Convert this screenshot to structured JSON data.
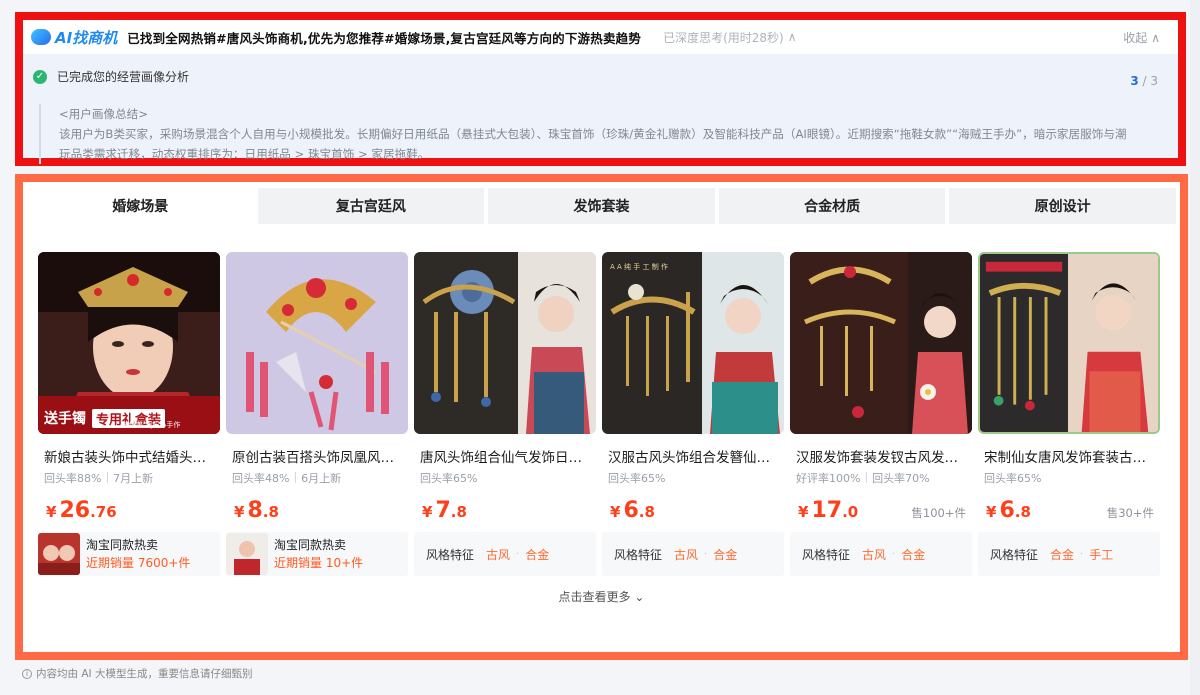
{
  "header": {
    "logo_text": "AI找商机",
    "headline": "已找到全网热销#唐风头饰商机,优先为您推荐#婚嫁场景,复古宫廷风等方向的下游热卖趋势",
    "thinking": "已深度思考(用时28秒)",
    "collapse_label": "收起"
  },
  "analysis": {
    "step_title": "已完成您的经营画像分析",
    "step_current": "3",
    "step_total": "/ 3",
    "summary_heading": "<用户画像总结>",
    "summary_body": "该用户为B类买家，采购场景混含个人自用与小规模批发。长期偏好日用纸品（悬挂式大包装）、珠宝首饰（珍珠/黄金礼赠款）及智能科技产品（AI眼镜）。近期搜索“拖鞋女款”“海贼王手办”，暗示家居服饰与潮玩品类需求迁移，动态权重排序为：日用纸品 > 珠宝首饰 > 家居拖鞋。"
  },
  "tabs": [
    {
      "label": "婚嫁场景"
    },
    {
      "label": "复古宫廷风"
    },
    {
      "label": "发饰套装"
    },
    {
      "label": "合金材质"
    },
    {
      "label": "原创设计"
    }
  ],
  "products": [
    {
      "title": "新娘古装头饰中式结婚头…",
      "meta1": "回头率88%",
      "meta2": "7月上新",
      "price_int": "26",
      "price_dec": ".76",
      "currency": "¥",
      "sold": "",
      "overlay1": "送手镯",
      "overlay2": "专用礼盒装",
      "overlay3": "苏绣美学|匠心手作",
      "foot_label": "淘宝同款热卖",
      "foot_sales": "近期销量 7600+件"
    },
    {
      "title": "原创古装百搭头饰凤凰风…",
      "meta1": "回头率48%",
      "meta2": "6月上新",
      "price_int": "8",
      "price_dec": ".8",
      "currency": "¥",
      "sold": "",
      "foot_label": "淘宝同款热卖",
      "foot_sales": "近期销量 10+件"
    },
    {
      "title": "唐风头饰组合仙气发饰日…",
      "meta1": "回头率65%",
      "meta2": "",
      "price_int": "7",
      "price_dec": ".8",
      "currency": "¥",
      "sold": "",
      "style_label": "风格特征",
      "tags": [
        "古风",
        "合金"
      ]
    },
    {
      "title": "汉服古风头饰组合发簪仙…",
      "meta1": "回头率65%",
      "meta2": "",
      "price_int": "6",
      "price_dec": ".8",
      "currency": "¥",
      "sold": "",
      "overlay1": "A A 纯 手 工 制 作",
      "style_label": "风格特征",
      "tags": [
        "古风",
        "合金"
      ]
    },
    {
      "title": "汉服发饰套装发钗古风发…",
      "meta1": "好评率100%",
      "meta2": "回头率70%",
      "price_int": "17",
      "price_dec": ".0",
      "currency": "¥",
      "sold": "售100+件",
      "style_label": "风格特征",
      "tags": [
        "古风",
        "合金"
      ]
    },
    {
      "title": "宋制仙女唐风发饰套装古…",
      "meta1": "回头率65%",
      "meta2": "",
      "price_int": "6",
      "price_dec": ".8",
      "currency": "¥",
      "sold": "售30+件",
      "style_label": "风格特征",
      "tags": [
        "合金",
        "手工"
      ]
    }
  ],
  "more_label": "点击查看更多",
  "disclaimer": "内容均由 AI 大模型生成，重要信息请仔细甄别",
  "colors": {
    "accent": "#ff3e1a",
    "tag": "#ff6a2f",
    "brand": "#1f8bf0",
    "frame_top": "#ee1111",
    "frame_bottom": "#ff6a44"
  }
}
